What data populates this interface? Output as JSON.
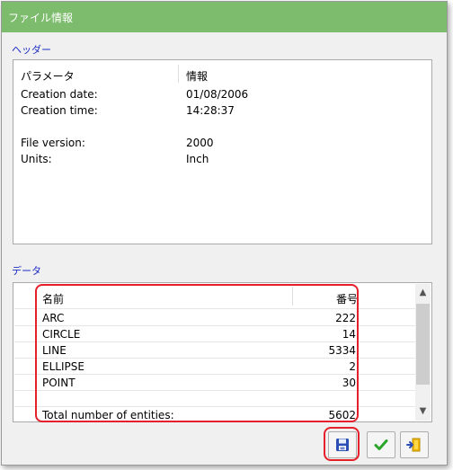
{
  "window": {
    "title": "ファイル情報"
  },
  "header_section": {
    "label": "ヘッダー",
    "col_param": "パラメータ",
    "col_info": "情報",
    "rows": [
      {
        "param": "Creation date:",
        "info": "01/08/2006"
      },
      {
        "param": "Creation time:",
        "info": "14:28:37"
      },
      {
        "param": "",
        "info": ""
      },
      {
        "param": "File version:",
        "info": "2000"
      },
      {
        "param": "Units:",
        "info": "Inch"
      }
    ]
  },
  "data_section": {
    "label": "データ",
    "col_name": "名前",
    "col_number": "番号",
    "rows": [
      {
        "name": "ARC",
        "value": "222"
      },
      {
        "name": "CIRCLE",
        "value": "14"
      },
      {
        "name": "LINE",
        "value": "5334"
      },
      {
        "name": "ELLIPSE",
        "value": "2"
      },
      {
        "name": "POINT",
        "value": "30"
      },
      {
        "name": "",
        "value": ""
      },
      {
        "name": "Total number of entities:",
        "value": "5602"
      }
    ]
  },
  "buttons": {
    "save": "save-icon",
    "ok": "checkmark-icon",
    "exit": "exit-icon"
  },
  "colors": {
    "titlebar": "#7cbc6c",
    "section_label": "#1d2bc6",
    "highlight": "#e5202a",
    "ok_green": "#2aa52a",
    "save_blue": "#2b4fb5"
  }
}
